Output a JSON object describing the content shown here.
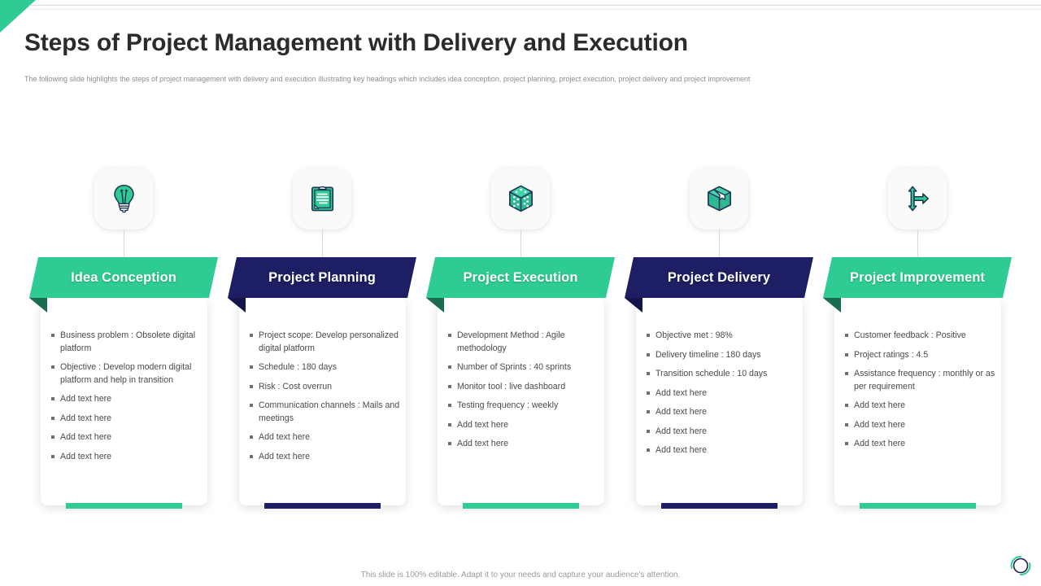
{
  "header": {
    "title": "Steps of Project Management with Delivery and Execution",
    "subtitle": "The following slide highlights the steps of project management  with delivery and execution illustrating key headings which includes idea conception, project planning,  project execution, project delivery and project improvement"
  },
  "footer": {
    "note": "This slide is 100% editable. Adapt it to your needs and capture your audience's attention."
  },
  "colors": {
    "green": "#2ecc92",
    "green_dark": "#1b6b52",
    "navy": "#1d1e63",
    "navy_dark": "#14154a",
    "title": "#2b2b2b",
    "body_text": "#4a4a4a",
    "muted": "#8d8d8d"
  },
  "steps": [
    {
      "label": "Idea Conception",
      "icon": "lightbulb-icon",
      "accent": "#2ecc92",
      "fold": "#1b6b52",
      "bullets": [
        "Business problem : Obsolete  digital platform",
        "Objective  : Develop modern  digital platform and help in transition",
        "Add text here",
        "Add text here",
        "Add text here",
        "Add text here"
      ]
    },
    {
      "label": "Project Planning",
      "icon": "clipboard-icon",
      "accent": "#1d1e63",
      "fold": "#14154a",
      "bullets": [
        "Project scope: Develop personalized  digital platform",
        "Schedule : 180 days",
        "Risk : Cost overrun",
        "Communication  channels : Mails and meetings",
        "Add text here",
        "Add text here"
      ]
    },
    {
      "label": "Project Execution",
      "icon": "dice-icon",
      "accent": "#2ecc92",
      "fold": "#1b6b52",
      "bullets": [
        "Development  Method : Agile methodology",
        "Number  of Sprints : 40 sprints",
        "Monitor tool : live  dashboard",
        "Testing frequency  : weekly",
        "Add text here",
        "Add text here"
      ]
    },
    {
      "label": "Project Delivery",
      "icon": "package-box-icon",
      "accent": "#1d1e63",
      "fold": "#14154a",
      "bullets": [
        "Objective  met : 98%",
        "Delivery  timeline : 180 days",
        "Transition  schedule : 10 days",
        "Add text here",
        "Add text here",
        "Add text here",
        "Add text here"
      ]
    },
    {
      "label": "Project Improvement",
      "icon": "direction-arrows-icon",
      "accent": "#2ecc92",
      "fold": "#1b6b52",
      "bullets": [
        "Customer feedback  : Positive",
        "Project ratings : 4.5",
        "Assistance frequency  : monthly or  as per requirement",
        "Add text here",
        "Add text here",
        "Add text here"
      ]
    }
  ]
}
